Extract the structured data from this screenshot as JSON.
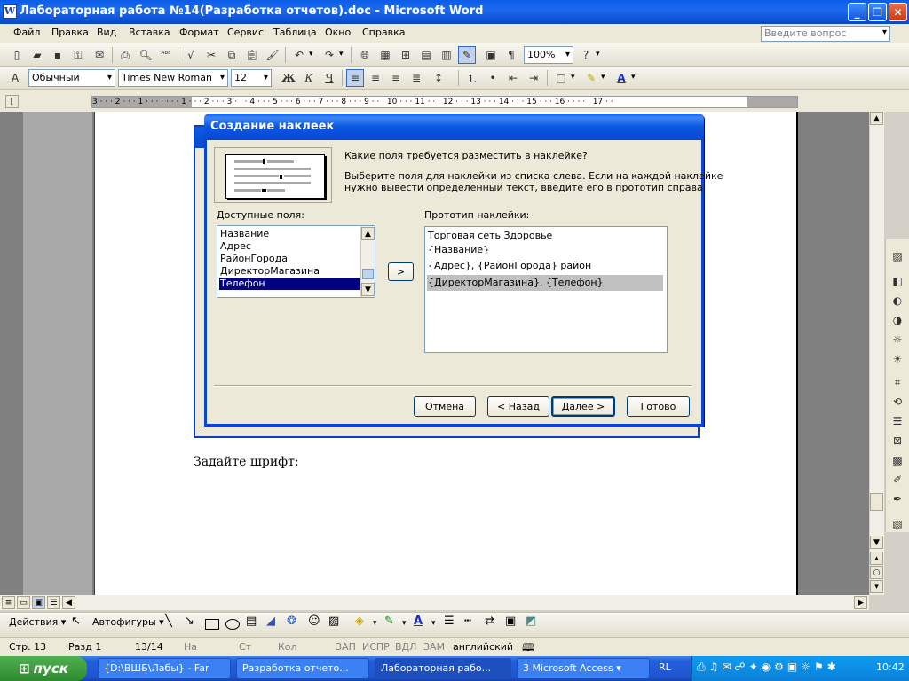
{
  "window": {
    "title": "Лабораторная работа №14(Разработка отчетов).doc - Microsoft Word"
  },
  "menu": {
    "items": [
      "Файл",
      "Правка",
      "Вид",
      "Вставка",
      "Формат",
      "Сервис",
      "Таблица",
      "Окно",
      "Справка"
    ],
    "ask_placeholder": "Введите вопрос"
  },
  "toolbar": {
    "zoom": "100%",
    "style": "Обычный",
    "font": "Times New Roman",
    "size": "12"
  },
  "ruler": {
    "labels": "3 · · · 2 · · · 1 · · · · · · · 1 · · · 2 · · · 3 · · · 4 · · · 5 · · · 6 · · · 7 · · · 8 · · · 9 · · · 10 · · · 11 · · · 12 · · · 13 · · · 14 · · · 15 · · · 16 · · · · · 17 · ·"
  },
  "document": {
    "text": "Задайте шрифт:"
  },
  "dialog": {
    "title": "Создание наклеек",
    "question": "Какие поля требуется разместить в наклейке?",
    "instruction_line1": "Выберите поля для наклейки из списка слева. Если на каждой наклейке",
    "instruction_line2": "нужно вывести определенный текст, введите его в прототип справа.",
    "available_label": "Доступные поля:",
    "available_fields": [
      "Название",
      "Адрес",
      "РайонГорода",
      "ДиректорМагазина",
      "Телефон"
    ],
    "selected_field": "Телефон",
    "add_button": ">",
    "prototype_label": "Прототип наклейки:",
    "prototype_lines": [
      "Торговая сеть Здоровье",
      "{Название}",
      "{Адрес}, {РайонГорода} район",
      "{ДиректорМагазина}, {Телефон}"
    ],
    "buttons": {
      "cancel": "Отмена",
      "back": "< Назад",
      "next": "Далее >",
      "finish": "Готово"
    }
  },
  "drawing_toolbar": {
    "actions": "Действия",
    "autoshapes": "Автофигуры"
  },
  "statusbar": {
    "page": "Стр.  13",
    "section": "Разд  1",
    "pages": "13/14",
    "at": "На",
    "line": "Ст",
    "col": "Кол",
    "rec": "ЗАП",
    "trk": "ИСПР",
    "ext": "ВДЛ",
    "ovr": "ЗАМ",
    "language": "английский"
  },
  "taskbar": {
    "start": "пуск",
    "tasks": [
      "{D:\\ВШБ\\Лабы} - Far",
      "Разработка отчето...",
      "Лабораторная рабо...",
      "3 Microsoft Access"
    ],
    "lang": "RL",
    "clock": "10:42"
  },
  "colors": {
    "xp_blue": "#0a5ce8",
    "selection": "#000080",
    "face": "#ece9d8"
  }
}
